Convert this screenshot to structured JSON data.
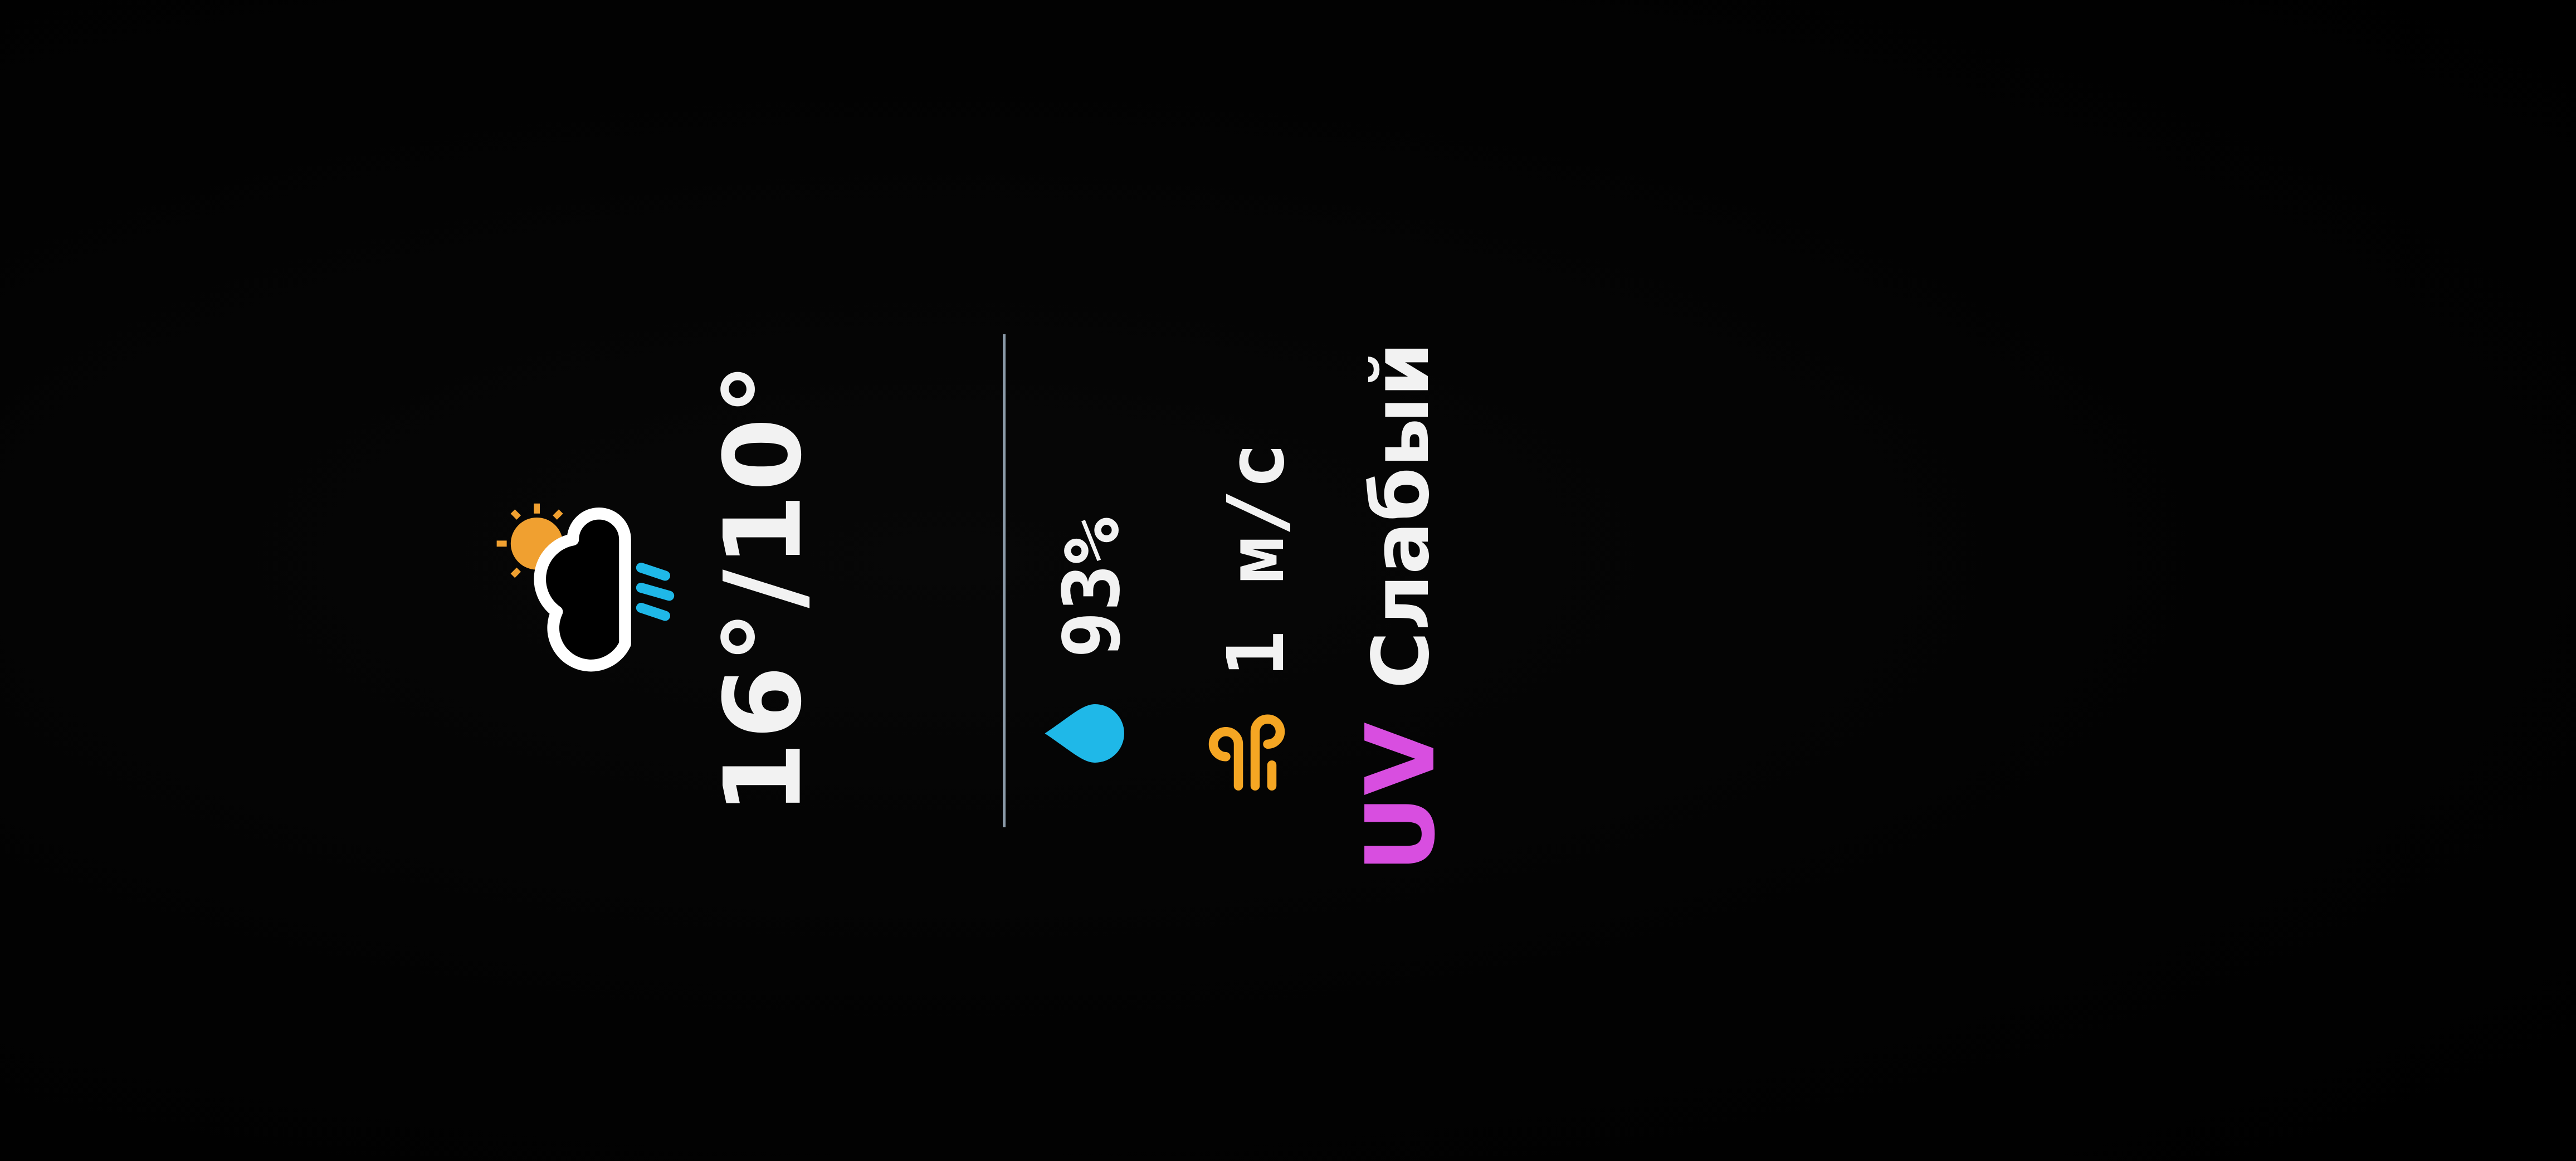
{
  "weather": {
    "icon": "partly-cloudy-rain-icon",
    "temperature": "16°/10°"
  },
  "details": {
    "humidity": {
      "icon": "water-drop-icon",
      "value": "93%"
    },
    "wind": {
      "icon": "wind-icon",
      "value": "1 м/с"
    },
    "uv": {
      "label": "UV",
      "value": "Слабый"
    }
  },
  "colors": {
    "sun": "#f0a030",
    "rain": "#1fb8e8",
    "drop": "#1fb8e8",
    "wind": "#f5a623",
    "uv": "#d84ee0",
    "divider": "#8a9aa8"
  }
}
